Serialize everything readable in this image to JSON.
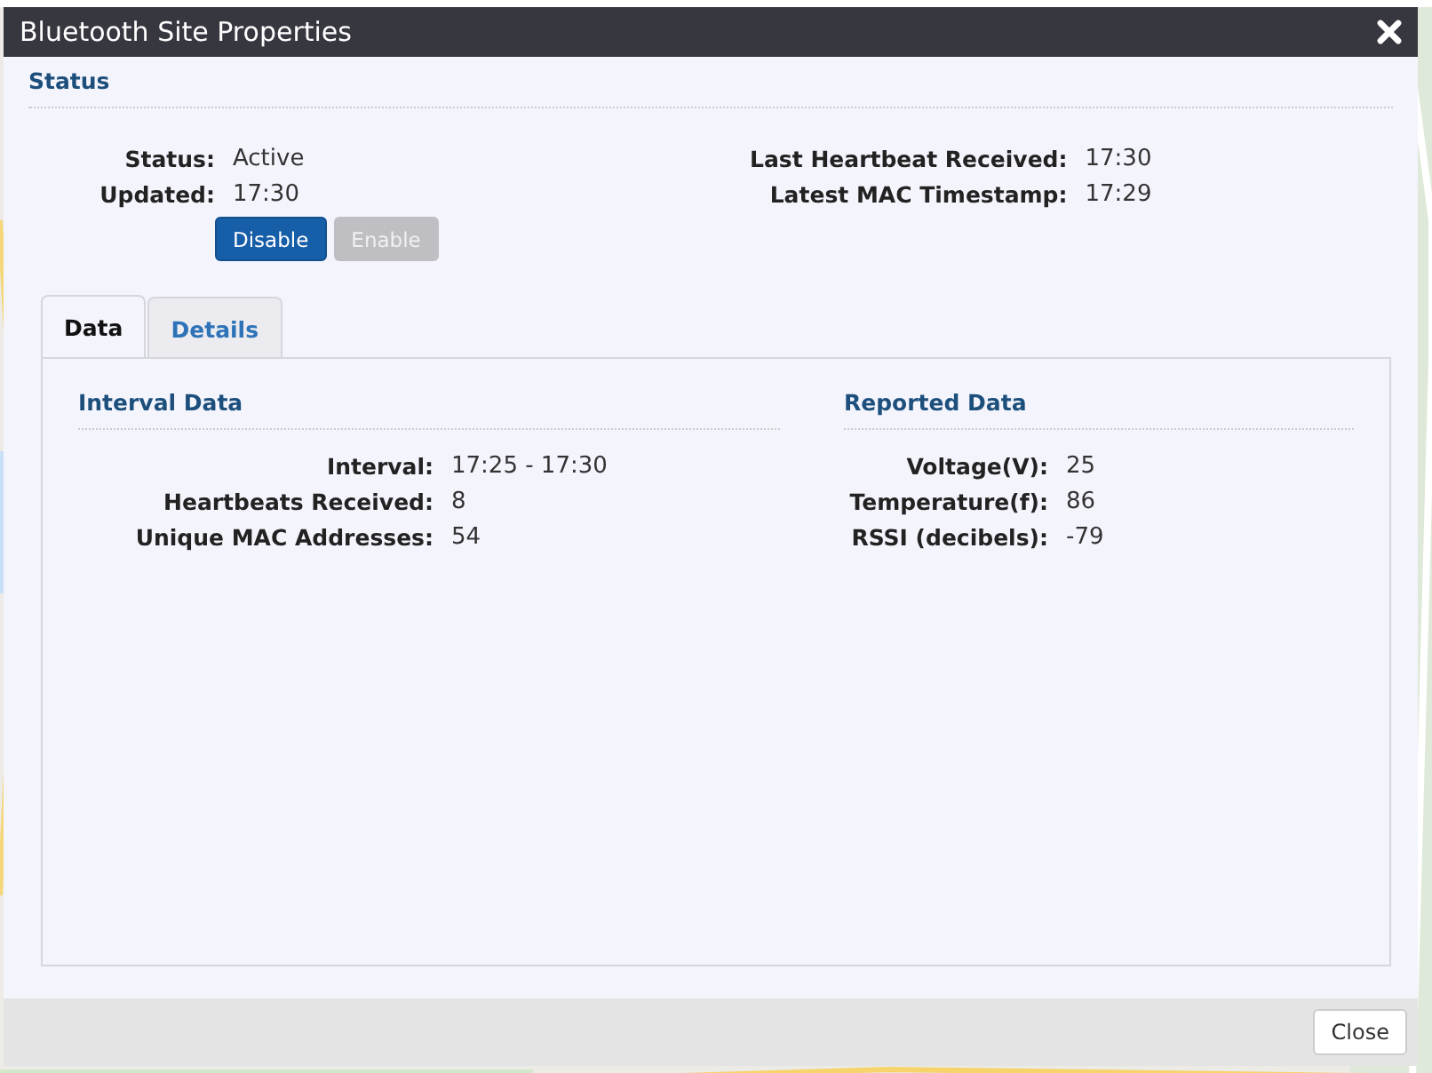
{
  "window": {
    "title": "Bluetooth Site Properties"
  },
  "status": {
    "heading": "Status",
    "left_fields": [
      {
        "label": "Status:",
        "value": "Active"
      },
      {
        "label": "Updated:",
        "value": "17:30"
      }
    ],
    "right_fields": [
      {
        "label": "Last Heartbeat Received:",
        "value": "17:30"
      },
      {
        "label": "Latest MAC Timestamp:",
        "value": "17:29"
      }
    ],
    "buttons": [
      {
        "label": "Disable",
        "disabled": false
      },
      {
        "label": "Enable",
        "disabled": true
      }
    ]
  },
  "tabs": [
    {
      "label": "Data",
      "selected": true
    },
    {
      "label": "Details",
      "selected": false
    }
  ],
  "interval_data": {
    "heading": "Interval Data",
    "fields": [
      {
        "label": "Interval:",
        "value": "17:25 - 17:30"
      },
      {
        "label": "Heartbeats Received:",
        "value": "8"
      },
      {
        "label": "Unique MAC Addresses:",
        "value": "54"
      }
    ]
  },
  "reported_data": {
    "heading": "Reported Data",
    "fields": [
      {
        "label": "Voltage(V):",
        "value": "25"
      },
      {
        "label": "Temperature(f):",
        "value": "86"
      },
      {
        "label": "RSSI (decibels):",
        "value": "-79"
      }
    ]
  },
  "footer": {
    "buttons": [
      "Close"
    ]
  }
}
